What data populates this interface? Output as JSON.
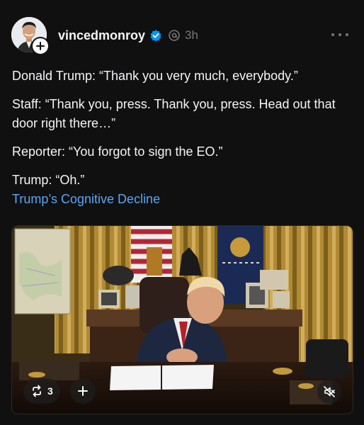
{
  "post": {
    "author": {
      "username": "vincedmonroy",
      "verified": true,
      "timestamp": "3h"
    },
    "lines": [
      "Donald Trump: “Thank you very much, everybody.”",
      "Staff: “Thank you, press. Thank you, press. Head out that door right there…”",
      "Reporter: “You forgot to sign the EO.”",
      "Trump: “Oh.”"
    ],
    "topic_link": "Trump’s Cognitive Decline",
    "media": {
      "repost_count": "3"
    }
  },
  "icons": {
    "follow": "plus-icon",
    "verified": "verified-badge-icon",
    "ai": "threads-label-icon",
    "more": "more-horizontal-icon",
    "repost": "repost-icon",
    "add": "plus-icon",
    "mute": "speaker-muted-icon"
  },
  "colors": {
    "background": "#101010",
    "text": "#f3f5f7",
    "muted": "#777777",
    "link": "#5aa6f3",
    "verified": "#0095f6"
  }
}
